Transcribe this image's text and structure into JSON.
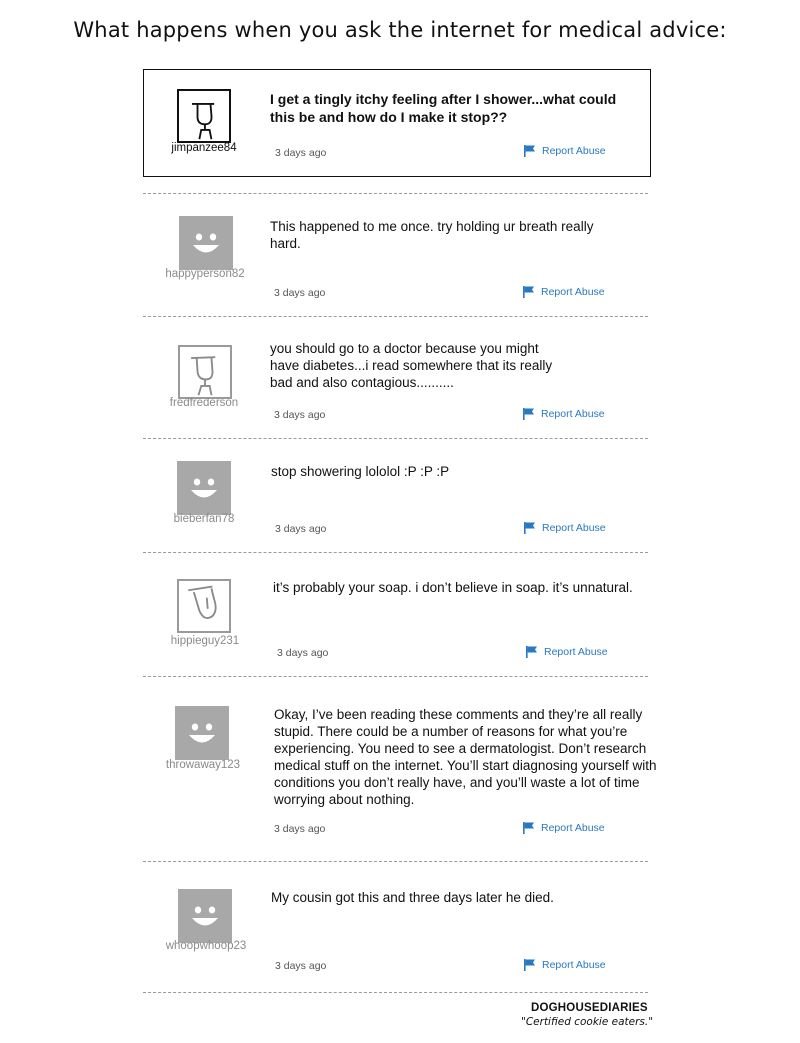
{
  "title": "What happens when you ask the internet for medical advice:",
  "posts": [
    {
      "username": "jimpanzee84",
      "text": "I get a tingly itchy feeling after I shower...what could this be and how do I make it stop??",
      "time": "3 days ago",
      "report": "Report Abuse",
      "avatar_icon": "stick-figure-icon"
    },
    {
      "username": "happyperson82",
      "text": "This happened to me once.  try holding ur breath really hard.",
      "time": "3 days ago",
      "report": "Report Abuse",
      "avatar_icon": "smiley-icon"
    },
    {
      "username": "fredfrederson",
      "text": "you should go to a doctor because you might have diabetes...i read somewhere that its really bad and also contagious..........",
      "time": "3 days ago",
      "report": "Report Abuse",
      "avatar_icon": "stick-figure-icon"
    },
    {
      "username": "bieberfan78",
      "text": "stop showering lololol :P :P :P",
      "time": "3 days ago",
      "report": "Report Abuse",
      "avatar_icon": "smiley-icon"
    },
    {
      "username": "hippieguy231",
      "text": "it’s probably your soap.  i don’t believe in soap.  it’s unnatural.",
      "time": "3 days ago",
      "report": "Report Abuse",
      "avatar_icon": "tilted-face-icon"
    },
    {
      "username": "throwaway123",
      "text": "Okay, I’ve been reading these comments and they’re all really stupid.  There could be a number of reasons for what you’re experiencing. You need to see a dermatologist.  Don’t research medical stuff on the internet. You’ll start diagnosing yourself with conditions you don’t really have, and you’ll waste a lot of time worrying about nothing.",
      "time": "3 days ago",
      "report": "Report Abuse",
      "avatar_icon": "smiley-icon"
    },
    {
      "username": "whoopwhoop23",
      "text": "My cousin got this and three days later he died.",
      "time": "3 days ago",
      "report": "Report Abuse",
      "avatar_icon": "smiley-icon"
    }
  ],
  "footer": {
    "brand": "DOGHOUSEDIARIES",
    "tagline": "\"Certified cookie eaters.\""
  },
  "colors": {
    "link": "#2a78c2",
    "smiley_bg": "#a8a8a8",
    "muted_text": "#8a8a8a"
  }
}
